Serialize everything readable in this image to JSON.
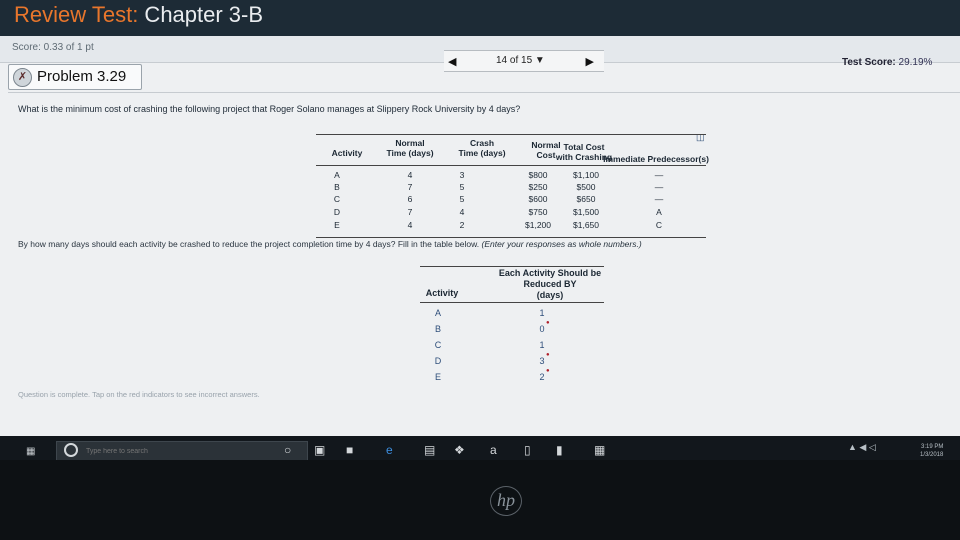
{
  "header": {
    "title_prefix": "Review Test:",
    "title_rest": " Chapter 3-B",
    "score": "Score: 0.33 of 1 pt",
    "nav_label": "14 of 15 ▼",
    "test_score_label": "Test Score:",
    "test_score_value": "29.19%"
  },
  "problem": {
    "title": "Problem 3.29",
    "question": "What is the minimum cost of crashing the following project that Roger Solano manages at Slippery Rock University by 4 days?"
  },
  "data_table": {
    "headers": {
      "activity": "Activity",
      "normal_time": [
        "Normal",
        "Time (days)"
      ],
      "crash_time": [
        "Crash",
        "Time (days)"
      ],
      "normal_cost": [
        "Normal",
        "Cost"
      ],
      "total_cost": [
        "Total Cost",
        "with Crashing"
      ],
      "predecessor": "Immediate Predecessor(s)"
    },
    "rows": [
      {
        "activity": "A",
        "normal_time": "4",
        "crash_time": "3",
        "normal_cost": "$800",
        "total_cost": "$1,100",
        "predecessor": "—"
      },
      {
        "activity": "B",
        "normal_time": "7",
        "crash_time": "5",
        "normal_cost": "$250",
        "total_cost": "$500",
        "predecessor": "—"
      },
      {
        "activity": "C",
        "normal_time": "6",
        "crash_time": "5",
        "normal_cost": "$600",
        "total_cost": "$650",
        "predecessor": "—"
      },
      {
        "activity": "D",
        "normal_time": "7",
        "crash_time": "4",
        "normal_cost": "$750",
        "total_cost": "$1,500",
        "predecessor": "A"
      },
      {
        "activity": "E",
        "normal_time": "4",
        "crash_time": "2",
        "normal_cost": "$1,200",
        "total_cost": "$1,650",
        "predecessor": "C"
      }
    ]
  },
  "instruction": {
    "text": "By how many days should each activity be crashed to reduce the project completion time by 4 days? Fill in the table below.",
    "hint": "(Enter your responses as whole numbers.)"
  },
  "answer_table": {
    "header_activity": "Activity",
    "header_reduced": [
      "Each Activity Should be",
      "Reduced BY",
      "(days)"
    ],
    "rows": [
      {
        "activity": "A",
        "value": "1",
        "incorrect": false
      },
      {
        "activity": "B",
        "value": "0",
        "incorrect": true
      },
      {
        "activity": "C",
        "value": "1",
        "incorrect": false
      },
      {
        "activity": "D",
        "value": "3",
        "incorrect": true
      },
      {
        "activity": "E",
        "value": "2",
        "incorrect": true
      }
    ]
  },
  "status": {
    "complete_text": "Question is complete. Tap on the red indicators to see incorrect answers."
  },
  "taskbar": {
    "search_placeholder": "Type here to search",
    "tray_icons": "▲ ◀ ◁",
    "time": "3:19 PM",
    "date": "1/3/2018"
  },
  "bezel": {
    "brand": "hp"
  }
}
